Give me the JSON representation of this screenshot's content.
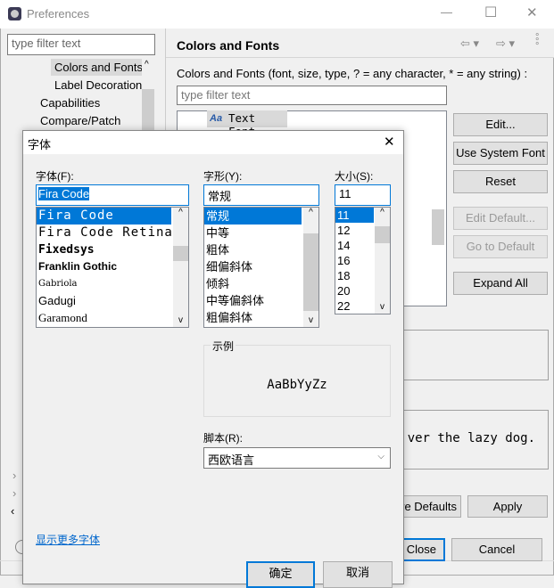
{
  "window": {
    "title": "Preferences",
    "minimize": "—",
    "maximize": "☐",
    "close": "✕"
  },
  "sidebar": {
    "filter_placeholder": "type filter text",
    "items": [
      {
        "label": "Colors and Fonts"
      },
      {
        "label": "Label Decorations"
      },
      {
        "label": "Capabilities"
      },
      {
        "label": "Compare/Patch"
      }
    ]
  },
  "main": {
    "title": "Colors and Fonts",
    "description": "Colors and Fonts (font, size, type, ? = any character, * = any string) :",
    "filter_placeholder": "type filter text",
    "tree_item": "Text Font",
    "tree_icon_text": "Aa",
    "buttons": {
      "edit": "Edit...",
      "use_system_font": "Use System Font",
      "reset": "Reset",
      "edit_default": "Edit Default...",
      "go_to_default": "Go to Default",
      "expand_all": "Expand All"
    },
    "preview_text": "ver the lazy dog.",
    "restore_defaults": "re Defaults",
    "apply": "Apply",
    "close": "Close",
    "cancel": "Cancel"
  },
  "font_dialog": {
    "title": "字体",
    "font_label": "字体(F):",
    "font_value": "Fira Code",
    "fonts": [
      "Fira Code",
      "Fira Code Retina",
      "Fixedsys",
      "Franklin Gothic",
      "Gabriola",
      "Gadugi",
      "Garamond"
    ],
    "style_label": "字形(Y):",
    "style_value": "常规",
    "styles": [
      "常规",
      "中等",
      "粗体",
      "细偏斜体",
      "倾斜",
      "中等偏斜体",
      "粗偏斜体"
    ],
    "size_label": "大小(S):",
    "size_value": "11",
    "sizes": [
      "11",
      "12",
      "14",
      "16",
      "18",
      "20",
      "22"
    ],
    "sample_label": "示例",
    "sample_text": "AaBbYyZz",
    "script_label": "脚本(R):",
    "script_value": "西欧语言",
    "more_fonts_link": "显示更多字体",
    "ok": "确定",
    "cancel": "取消"
  },
  "colors": {
    "accent": "#0078d7",
    "link": "#0066cc"
  }
}
